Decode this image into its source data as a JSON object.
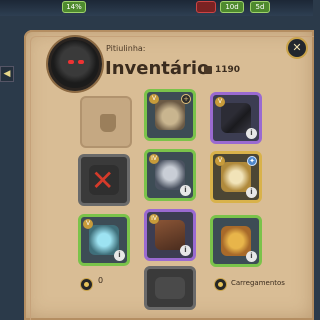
{
  "hud": {
    "percent": "14%",
    "days_a": "10d",
    "days_b": "5d"
  },
  "header": {
    "owner": "Pitiulinha:",
    "title": "Inventário",
    "silver": "1190"
  },
  "footer": {
    "count": "0",
    "loadouts_label": "Carregamentos"
  },
  "slots": [
    {
      "name": "empty-bag-slot",
      "state": "empty"
    },
    {
      "name": "mount-beast-slot",
      "state": "green",
      "tier": "V"
    },
    {
      "name": "weapon-scythe-slot",
      "state": "purple",
      "tier": "V"
    },
    {
      "name": "blocked-slot",
      "state": "gray",
      "tier": ""
    },
    {
      "name": "armor-plate-slot",
      "state": "green",
      "tier": "IV"
    },
    {
      "name": "shield-slot",
      "state": "gold",
      "tier": "V"
    },
    {
      "name": "relic-slot",
      "state": "green",
      "tier": "V"
    },
    {
      "name": "boots-slot",
      "state": "purple",
      "tier": "IV"
    },
    {
      "name": "food-bowl-slot",
      "state": "green",
      "tier": ""
    },
    {
      "name": "armor-dark-slot",
      "state": "gray",
      "tier": ""
    }
  ]
}
